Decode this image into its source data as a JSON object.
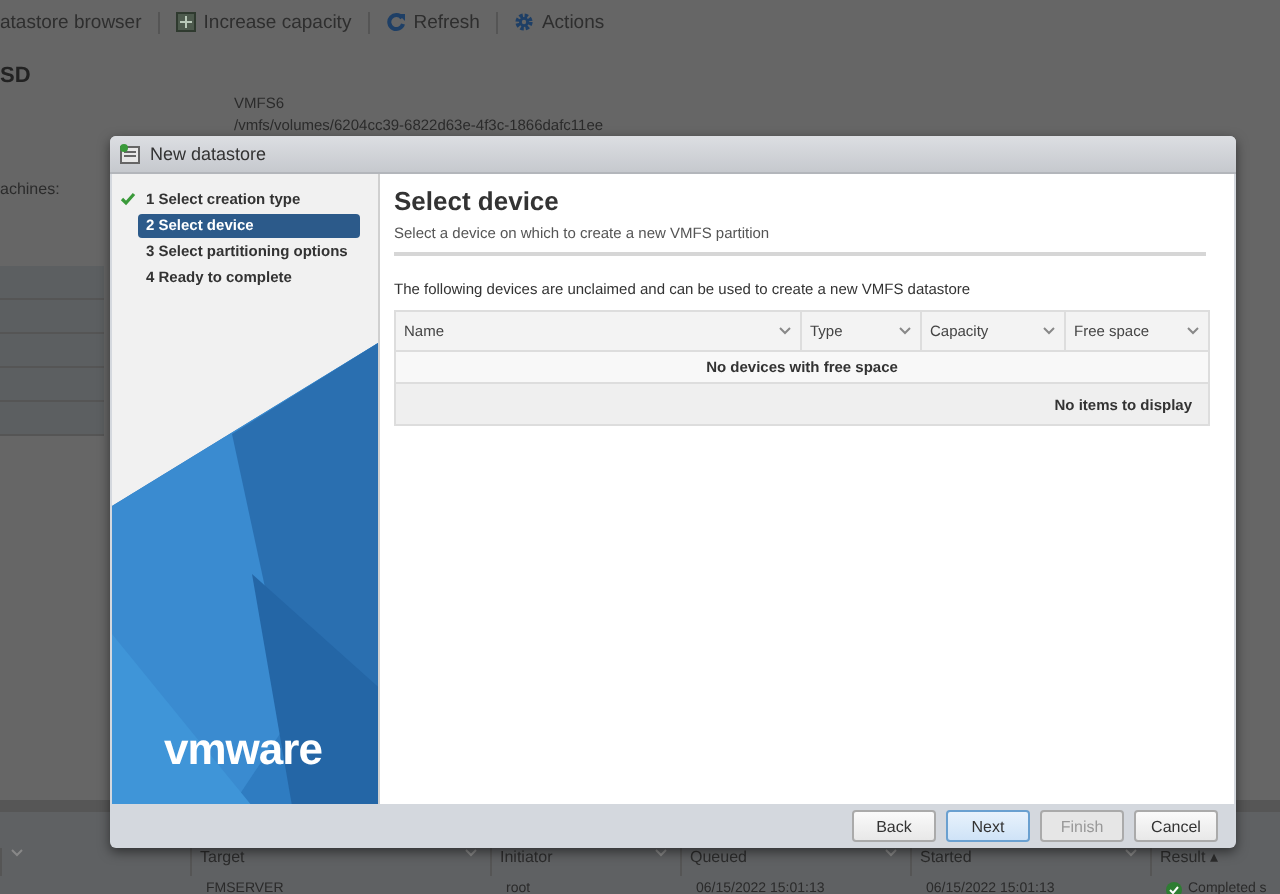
{
  "background": {
    "toolbar": [
      "atastore browser",
      "Increase capacity",
      "Refresh",
      "Actions"
    ],
    "heading": "SD",
    "fs_type": "VMFS6",
    "path": "/vmfs/volumes/6204cc39-6822d63e-4f3c-1866dafc11ee",
    "label": "achines:",
    "tasks": {
      "columns": [
        "",
        "Target",
        "Initiator",
        "Queued",
        "Started",
        "Result ▴"
      ],
      "row": [
        "FMSERVER",
        "root",
        "06/15/2022 15:01:13",
        "06/15/2022 15:01:13",
        "Completed s"
      ]
    }
  },
  "dialog": {
    "title": "New datastore",
    "steps": [
      {
        "label": "1 Select creation type",
        "done": true,
        "selected": false
      },
      {
        "label": "2 Select device",
        "done": false,
        "selected": true
      },
      {
        "label": "3 Select partitioning options",
        "done": false,
        "selected": false
      },
      {
        "label": "4 Ready to complete",
        "done": false,
        "selected": false
      }
    ],
    "logo": "vmware",
    "heading": "Select device",
    "subtitle": "Select a device on which to create a new VMFS partition",
    "intro": "The following devices are unclaimed and can be used to create a new VMFS datastore",
    "table": {
      "columns": [
        "Name",
        "Type",
        "Capacity",
        "Free space"
      ],
      "empty_message": "No devices with free space",
      "footer": "No items to display"
    },
    "buttons": [
      {
        "label": "Back",
        "primary": false,
        "disabled": false
      },
      {
        "label": "Next",
        "primary": true,
        "disabled": false
      },
      {
        "label": "Finish",
        "primary": false,
        "disabled": true
      },
      {
        "label": "Cancel",
        "primary": false,
        "disabled": false
      }
    ]
  }
}
